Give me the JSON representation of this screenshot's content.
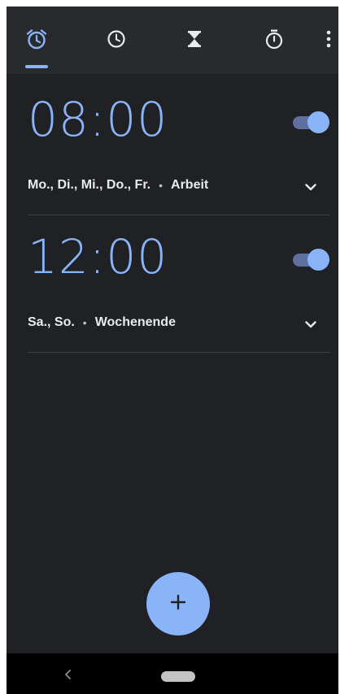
{
  "tabs": [
    {
      "icon": "alarm-icon",
      "active": true
    },
    {
      "icon": "clock-icon",
      "active": false
    },
    {
      "icon": "timer-icon",
      "active": false
    },
    {
      "icon": "stopwatch-icon",
      "active": false
    }
  ],
  "overflow_icon": "more-vert-icon",
  "alarms": [
    {
      "time": "08:00",
      "enabled": true,
      "days": "Mo., Di., Mi., Do., Fr.",
      "separator": "•",
      "label": "Arbeit"
    },
    {
      "time": "12:00",
      "enabled": true,
      "days": "Sa., So.",
      "separator": "•",
      "label": "Wochenende"
    }
  ],
  "fab": {
    "label": "+",
    "icon": "add-icon"
  },
  "nav": {
    "back_icon": "back-icon",
    "home_icon": "home-pill-icon"
  },
  "colors": {
    "accent": "#8ab4f8",
    "background": "#202124",
    "tabbar": "#292a2d",
    "text": "#e8eaed",
    "inactive_icon": "#e8eaed",
    "divider": "#3c4043",
    "toggle_track": "#5f6fa0",
    "navbar": "#000000"
  }
}
